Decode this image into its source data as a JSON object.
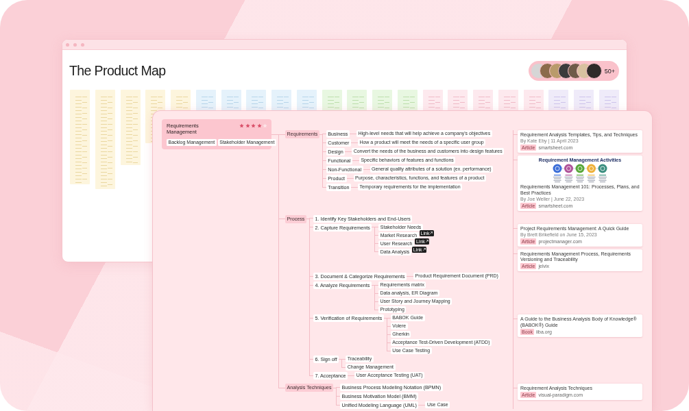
{
  "window": {
    "title": "The Product Map"
  },
  "contributors": {
    "more": "50+"
  },
  "topic": {
    "title": "Requirements Management",
    "stars": 4,
    "tags": [
      "Backlog Management",
      "Stakeholder Management"
    ]
  },
  "branches": [
    {
      "label": "Requirements",
      "children": [
        {
          "label": "Business",
          "children": [
            {
              "label": "High-level needs that will help achieve a company's objectives"
            }
          ]
        },
        {
          "label": "Customer",
          "children": [
            {
              "label": "How a product will meet the needs of a specific user group"
            }
          ]
        },
        {
          "label": "Design",
          "children": [
            {
              "label": "Convert the needs of the business and customers into design features"
            }
          ]
        },
        {
          "label": "Functional",
          "children": [
            {
              "label": "Specific behaviors of features and functions"
            }
          ]
        },
        {
          "label": "Non-Functional",
          "children": [
            {
              "label": "General quality attributes of a solution (ex. performance)"
            }
          ]
        },
        {
          "label": "Product",
          "children": [
            {
              "label": "Purpose, characteristics, functions, and features of a product"
            }
          ]
        },
        {
          "label": "Transition",
          "children": [
            {
              "label": "Temporary requirements for the implementation"
            }
          ]
        }
      ],
      "resources": [
        {
          "title": "Requirement Analysis Templates, Tips, and Techniques",
          "byline": "By Kate Eby | 11 April 2023",
          "type": "Article",
          "source": "smartsheet.com"
        },
        {
          "image": {
            "title": "Requirement Management Activities"
          },
          "title": "Requirements Management 101: Processes, Plans, and Best Practices",
          "byline": "By Joe Weller | June 22, 2023",
          "type": "Article",
          "source": "smartsheet.com"
        }
      ]
    },
    {
      "label": "Process",
      "children": [
        {
          "label": "1. Identify Key Stakeholders and End-Users"
        },
        {
          "label": "2. Capture Requirements",
          "children": [
            {
              "label": "Stakeholder Needs"
            },
            {
              "label": "Market Research",
              "link": "Link"
            },
            {
              "label": "User Research",
              "link": "Link"
            },
            {
              "label": "Data Analysis",
              "link": "Link"
            }
          ],
          "resources": [
            {
              "title": "Project Requirements Management: A Quick Guide",
              "byline": "By Brett Brikefield on June 15, 2023",
              "type": "Article",
              "source": "projectmanager.com"
            },
            {
              "title": "Requirements Management Process, Requirements Versioning and Traceability",
              "type": "Article",
              "source": "jelvix"
            }
          ]
        },
        {
          "label": "3. Document & Categorize Requirements",
          "children": [
            {
              "label": "Product Requirement Document (PRD)"
            }
          ]
        },
        {
          "label": "4. Analyze Requirements",
          "children": [
            {
              "label": "Requirements matrix"
            },
            {
              "label": "Data analysis, ER Diagram"
            },
            {
              "label": "User Story and Journey Mapping"
            },
            {
              "label": "Prototyping"
            }
          ]
        },
        {
          "label": "5. Verification of Requirements",
          "children": [
            {
              "label": "BABOK Guide"
            },
            {
              "label": "Volere"
            },
            {
              "label": "Gherkin"
            },
            {
              "label": "Acceptance Test-Driven Development (ATDD)"
            },
            {
              "label": "Use Case Testing"
            }
          ],
          "resources": [
            {
              "title": "A Guide to the Business Analysis Body of Knowledge® (BABOK®) Guide",
              "type": "Book",
              "source": "iiba.org"
            }
          ]
        },
        {
          "label": "6. Sign off",
          "children": [
            {
              "label": "Traceability"
            },
            {
              "label": "Change Management"
            }
          ]
        },
        {
          "label": "7. Acceptance",
          "children": [
            {
              "label": "User Acceptance Testing (UAT)"
            }
          ]
        }
      ]
    },
    {
      "label": "Analysis Techniques",
      "children": [
        {
          "label": "Business Process Modeling Notation (BPMN)"
        },
        {
          "label": "Business Motivation Model (BMM)"
        },
        {
          "label": "Unified Modeling Language (UML)",
          "children": [
            {
              "label": "Use Case"
            }
          ]
        }
      ],
      "resources": [
        {
          "title": "Requirement Analysis Techniques",
          "type": "Article",
          "source": "visual-paradigm.com"
        }
      ]
    }
  ]
}
